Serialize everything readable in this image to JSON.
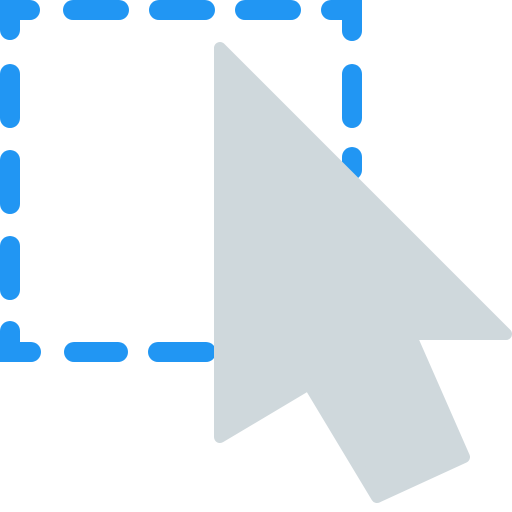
{
  "icon": {
    "name": "selection-cursor-icon",
    "parts": {
      "selection": "dashed-selection-rectangle-icon",
      "cursor": "mouse-pointer-arrow-icon"
    }
  },
  "colors": {
    "background": "#ffffff",
    "selection_dash": "#2196f3",
    "cursor_fill": "#cfd8dc"
  }
}
